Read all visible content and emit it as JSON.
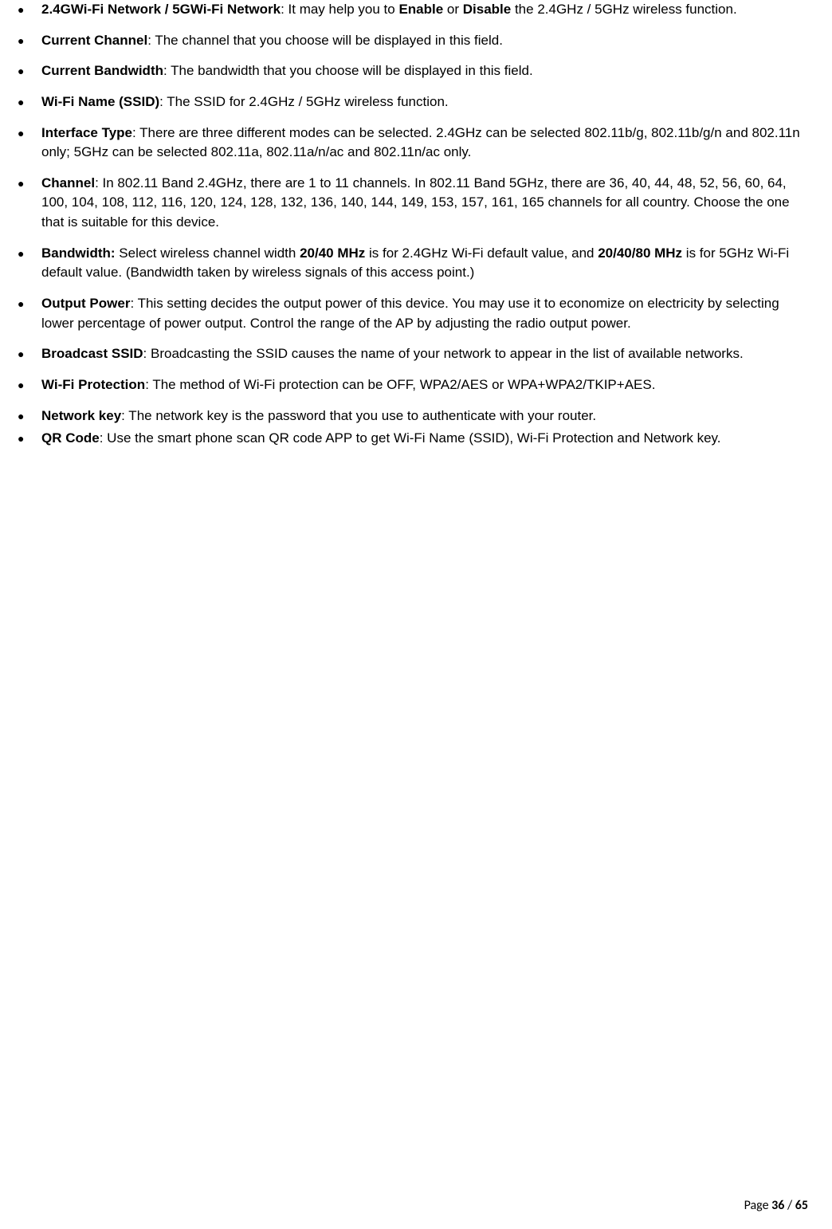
{
  "items": [
    {
      "term": "2.4GWi-Fi Network / 5GWi-Fi Network",
      "pre": ": It may help you to ",
      "bold1": "Enable",
      "mid": " or ",
      "bold2": "Disable",
      "post": " the 2.4GHz / 5GHz wireless function."
    },
    {
      "term": "Current Channel",
      "desc": ": The channel that you choose will be displayed in this field."
    },
    {
      "term": "Current Bandwidth",
      "desc": ": The bandwidth that you choose will be displayed in this field."
    },
    {
      "term": "Wi-Fi Name (SSID)",
      "desc": ": The SSID for 2.4GHz / 5GHz wireless function."
    },
    {
      "term": "Interface Type",
      "desc": ": There are three different modes can be selected. 2.4GHz can be selected 802.11b/g, 802.11b/g/n and 802.11n only; 5GHz can be selected 802.11a, 802.11a/n/ac and 802.11n/ac only."
    },
    {
      "term": "Channel",
      "desc": ": In 802.11 Band 2.4GHz, there are 1 to 11 channels. In 802.11 Band 5GHz, there are 36, 40, 44, 48, 52, 56, 60, 64, 100, 104, 108, 112, 116, 120, 124, 128, 132, 136, 140, 144, 149, 153, 157, 161, 165 channels for all country. Choose the one that is suitable for this device."
    },
    {
      "term": "Bandwidth:",
      "pre": " Select wireless channel width ",
      "bold1": "20/40 MHz",
      "mid": " is for 2.4GHz Wi-Fi default value, and ",
      "bold2": "20/40/80 MHz",
      "post": " is for 5GHz Wi-Fi default value. (Bandwidth taken by wireless signals of this access point.)"
    },
    {
      "term": "Output Power",
      "desc": ": This setting decides the output power of this device. You may use it to economize on electricity by selecting lower percentage of power output. Control the range of the AP by adjusting the radio output power."
    },
    {
      "term": "Broadcast SSID",
      "desc": ": Broadcasting the SSID causes the name of your network to appear in the list of available networks."
    },
    {
      "term": "Wi-Fi Protection",
      "desc": ": The method of Wi-Fi protection can be OFF, WPA2/AES or WPA+WPA2/TKIP+AES."
    },
    {
      "term": "Network key",
      "desc": ": The network key is the password that you use to authenticate with your router."
    },
    {
      "term": "QR Code",
      "desc": ": Use the smart phone scan QR code APP to get Wi-Fi Name (SSID), Wi-Fi Protection and Network key."
    }
  ],
  "footer": {
    "prefix": "Page ",
    "current": "36",
    "sep": " / ",
    "total": "65"
  }
}
